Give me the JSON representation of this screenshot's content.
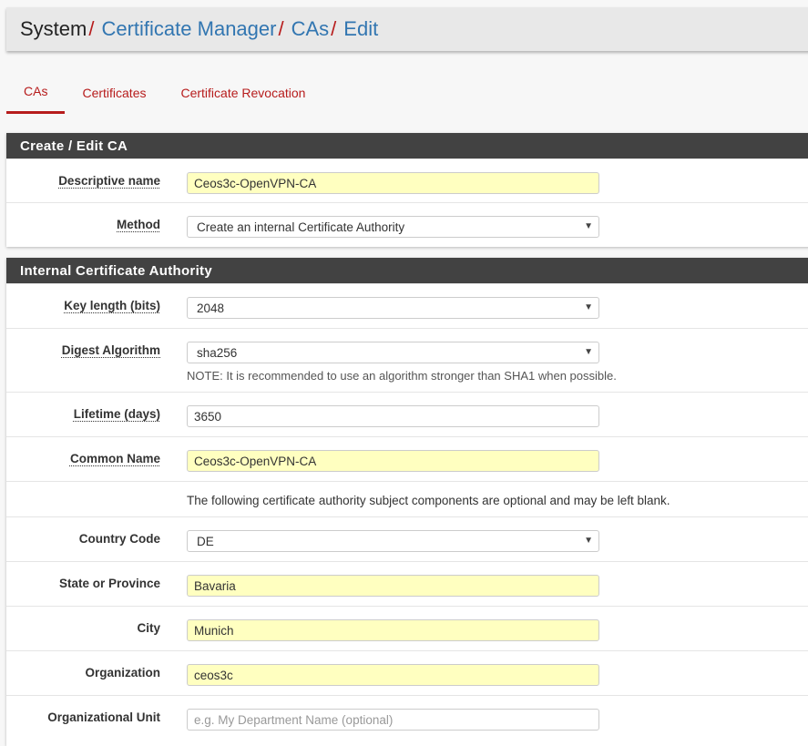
{
  "breadcrumb": {
    "items": [
      "System",
      "Certificate Manager",
      "CAs",
      "Edit"
    ],
    "separator": "/"
  },
  "tabs": [
    "CAs",
    "Certificates",
    "Certificate Revocation"
  ],
  "panel1": {
    "title": "Create / Edit CA",
    "descriptive_name": {
      "label": "Descriptive name",
      "value": "Ceos3c-OpenVPN-CA"
    },
    "method": {
      "label": "Method",
      "value": "Create an internal Certificate Authority"
    }
  },
  "panel2": {
    "title": "Internal Certificate Authority",
    "key_length": {
      "label": "Key length (bits)",
      "value": "2048"
    },
    "digest": {
      "label": "Digest Algorithm",
      "value": "sha256",
      "note": "NOTE: It is recommended to use an algorithm stronger than SHA1 when possible."
    },
    "lifetime": {
      "label": "Lifetime (days)",
      "value": "3650"
    },
    "common_name": {
      "label": "Common Name",
      "value": "Ceos3c-OpenVPN-CA"
    },
    "optional_info": "The following certificate authority subject components are optional and may be left blank.",
    "country": {
      "label": "Country Code",
      "value": "DE"
    },
    "state": {
      "label": "State or Province",
      "value": "Bavaria"
    },
    "city": {
      "label": "City",
      "value": "Munich"
    },
    "organization": {
      "label": "Organization",
      "value": "ceos3c"
    },
    "org_unit": {
      "label": "Organizational Unit",
      "value": "",
      "placeholder": "e.g. My Department Name (optional)"
    }
  },
  "colors": {
    "accent": "#b71c1c",
    "link": "#3276b1",
    "panel_heading": "#424242",
    "filled_input": "#ffffc0"
  },
  "icons": {
    "select_caret": "▼"
  }
}
